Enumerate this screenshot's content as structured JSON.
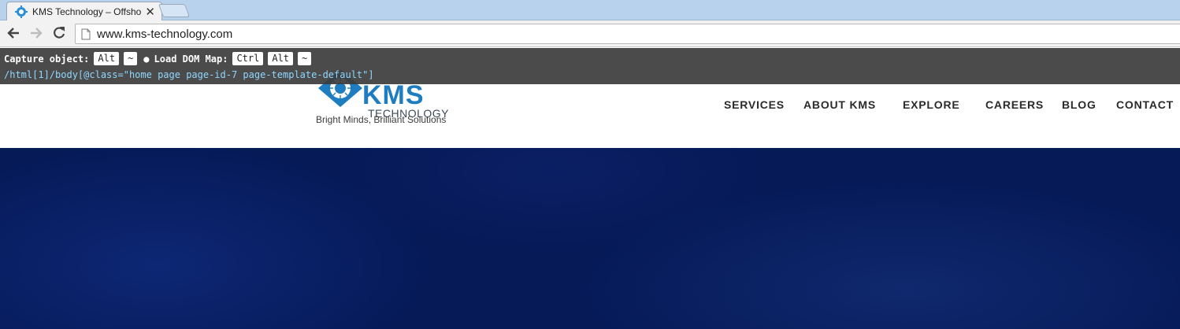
{
  "browser": {
    "tab": {
      "title": "KMS Technology – Offsho",
      "close_glyph": "✕"
    },
    "address": "www.kms-technology.com"
  },
  "overlay": {
    "capture_label": "Capture object:",
    "capture_keys": [
      "Alt",
      "~"
    ],
    "bullet": "●",
    "load_label": "Load DOM Map:",
    "load_keys": [
      "Ctrl",
      "Alt",
      "~"
    ],
    "xpath": "/html[1]/body[@class=\"home page page-id-7 page-template-default\"]"
  },
  "site": {
    "logo_text": "KMS",
    "logo_sub": "TECHNOLOGY",
    "tagline": "Bright Minds, Brilliant Solutions",
    "nav": [
      "SERVICES",
      "ABOUT KMS",
      "EXPLORE",
      "CAREERS",
      "BLOG",
      "CONTACT"
    ]
  },
  "colors": {
    "brand": "#1e7cc0",
    "hero": "#061a58",
    "overlay_bg": "#3c3c3c",
    "xpath": "#8fd7ff"
  }
}
